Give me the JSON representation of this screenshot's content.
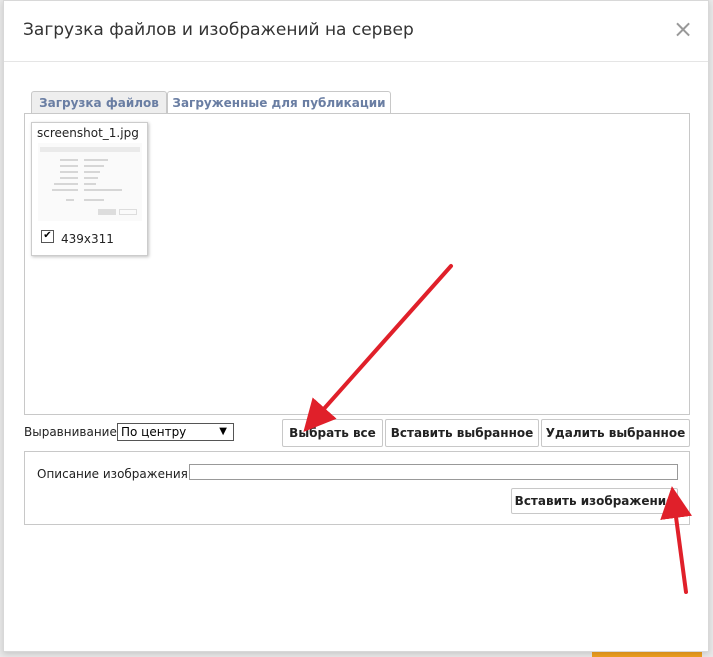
{
  "dialog": {
    "title": "Загрузка файлов и изображений на сервер",
    "close_glyph": "×"
  },
  "tabs": [
    {
      "label": "Загрузка файлов"
    },
    {
      "label": "Загруженные для публикации"
    }
  ],
  "file": {
    "name": "screenshot_1.jpg",
    "dimensions": "439x311",
    "checked": true
  },
  "alignment": {
    "label": "Выравнивание:",
    "selected": "По центру",
    "arrow": "▼"
  },
  "buttons": {
    "select_all": "Выбрать все",
    "insert_selected": "Вставить выбранное",
    "delete_selected": "Удалить выбранное",
    "insert_image": "Вставить изображение"
  },
  "description": {
    "label": "Описание изображения:",
    "value": ""
  },
  "colors": {
    "annotation_arrow": "#e0202a",
    "tab_text": "#6a7ea3"
  }
}
